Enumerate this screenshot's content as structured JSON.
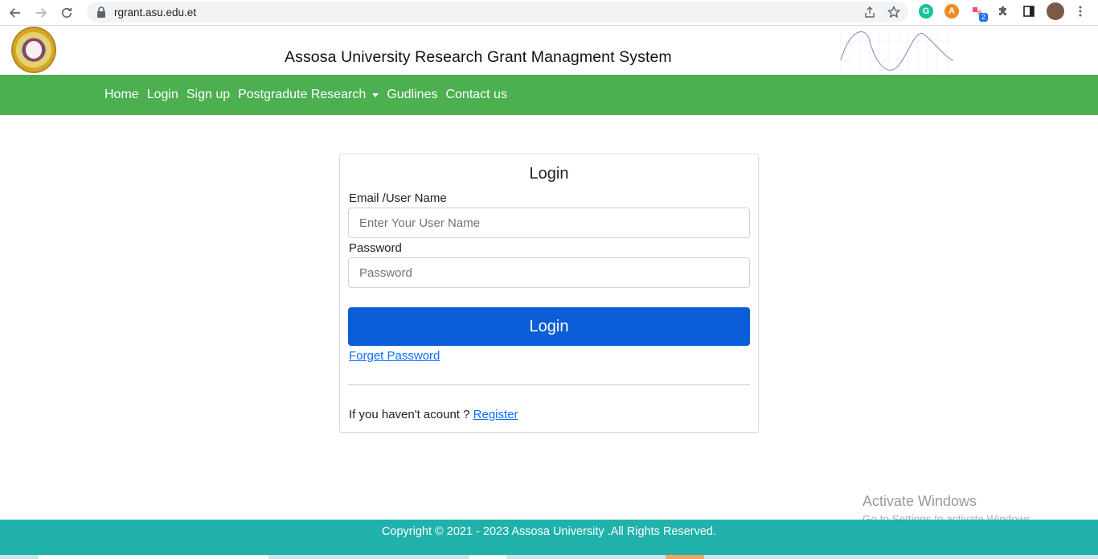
{
  "browser": {
    "url": "rgrant.asu.edu.et",
    "extension_badge": "2"
  },
  "header": {
    "title": "Assosa University Research Grant Managment System"
  },
  "nav": {
    "items": [
      "Home",
      "Login",
      "Sign up",
      "Postgradute Research",
      "Gudlines",
      "Contact us"
    ]
  },
  "login": {
    "title": "Login",
    "username_label": "Email /User Name",
    "username_placeholder": "Enter Your User Name",
    "password_label": "Password",
    "password_placeholder": "Password",
    "submit_label": "Login",
    "forget_label": "Forget Password",
    "register_prompt": "If you haven't acount ?",
    "register_label": "Register"
  },
  "watermark": {
    "line1": "Activate Windows",
    "line2": "Go to Settings to activate Windows."
  },
  "footer": {
    "copyright": "Copyright © 2021 - 2023 Assosa University .All Rights Reserved."
  },
  "colors": {
    "navbar": "#4caf50",
    "primary_button": "#0b5ed7",
    "footer": "#20b2aa",
    "link": "#0d6efd"
  }
}
